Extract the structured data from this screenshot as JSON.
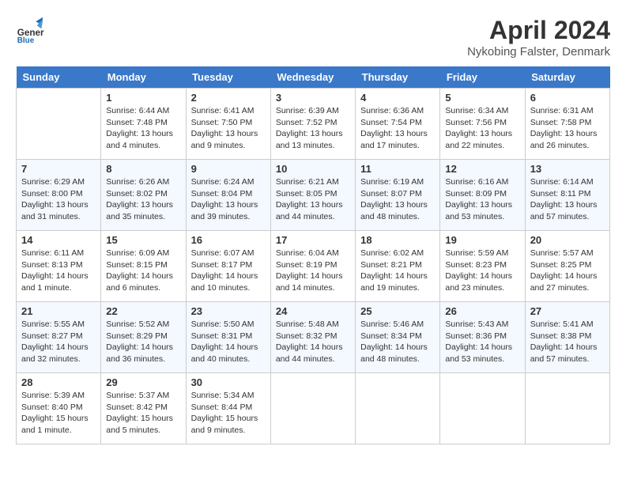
{
  "header": {
    "logo_line1": "General",
    "logo_line2": "Blue",
    "month": "April 2024",
    "location": "Nykobing Falster, Denmark"
  },
  "days_of_week": [
    "Sunday",
    "Monday",
    "Tuesday",
    "Wednesday",
    "Thursday",
    "Friday",
    "Saturday"
  ],
  "weeks": [
    [
      {
        "day": "",
        "info": ""
      },
      {
        "day": "1",
        "info": "Sunrise: 6:44 AM\nSunset: 7:48 PM\nDaylight: 13 hours\nand 4 minutes."
      },
      {
        "day": "2",
        "info": "Sunrise: 6:41 AM\nSunset: 7:50 PM\nDaylight: 13 hours\nand 9 minutes."
      },
      {
        "day": "3",
        "info": "Sunrise: 6:39 AM\nSunset: 7:52 PM\nDaylight: 13 hours\nand 13 minutes."
      },
      {
        "day": "4",
        "info": "Sunrise: 6:36 AM\nSunset: 7:54 PM\nDaylight: 13 hours\nand 17 minutes."
      },
      {
        "day": "5",
        "info": "Sunrise: 6:34 AM\nSunset: 7:56 PM\nDaylight: 13 hours\nand 22 minutes."
      },
      {
        "day": "6",
        "info": "Sunrise: 6:31 AM\nSunset: 7:58 PM\nDaylight: 13 hours\nand 26 minutes."
      }
    ],
    [
      {
        "day": "7",
        "info": "Sunrise: 6:29 AM\nSunset: 8:00 PM\nDaylight: 13 hours\nand 31 minutes."
      },
      {
        "day": "8",
        "info": "Sunrise: 6:26 AM\nSunset: 8:02 PM\nDaylight: 13 hours\nand 35 minutes."
      },
      {
        "day": "9",
        "info": "Sunrise: 6:24 AM\nSunset: 8:04 PM\nDaylight: 13 hours\nand 39 minutes."
      },
      {
        "day": "10",
        "info": "Sunrise: 6:21 AM\nSunset: 8:05 PM\nDaylight: 13 hours\nand 44 minutes."
      },
      {
        "day": "11",
        "info": "Sunrise: 6:19 AM\nSunset: 8:07 PM\nDaylight: 13 hours\nand 48 minutes."
      },
      {
        "day": "12",
        "info": "Sunrise: 6:16 AM\nSunset: 8:09 PM\nDaylight: 13 hours\nand 53 minutes."
      },
      {
        "day": "13",
        "info": "Sunrise: 6:14 AM\nSunset: 8:11 PM\nDaylight: 13 hours\nand 57 minutes."
      }
    ],
    [
      {
        "day": "14",
        "info": "Sunrise: 6:11 AM\nSunset: 8:13 PM\nDaylight: 14 hours\nand 1 minute."
      },
      {
        "day": "15",
        "info": "Sunrise: 6:09 AM\nSunset: 8:15 PM\nDaylight: 14 hours\nand 6 minutes."
      },
      {
        "day": "16",
        "info": "Sunrise: 6:07 AM\nSunset: 8:17 PM\nDaylight: 14 hours\nand 10 minutes."
      },
      {
        "day": "17",
        "info": "Sunrise: 6:04 AM\nSunset: 8:19 PM\nDaylight: 14 hours\nand 14 minutes."
      },
      {
        "day": "18",
        "info": "Sunrise: 6:02 AM\nSunset: 8:21 PM\nDaylight: 14 hours\nand 19 minutes."
      },
      {
        "day": "19",
        "info": "Sunrise: 5:59 AM\nSunset: 8:23 PM\nDaylight: 14 hours\nand 23 minutes."
      },
      {
        "day": "20",
        "info": "Sunrise: 5:57 AM\nSunset: 8:25 PM\nDaylight: 14 hours\nand 27 minutes."
      }
    ],
    [
      {
        "day": "21",
        "info": "Sunrise: 5:55 AM\nSunset: 8:27 PM\nDaylight: 14 hours\nand 32 minutes."
      },
      {
        "day": "22",
        "info": "Sunrise: 5:52 AM\nSunset: 8:29 PM\nDaylight: 14 hours\nand 36 minutes."
      },
      {
        "day": "23",
        "info": "Sunrise: 5:50 AM\nSunset: 8:31 PM\nDaylight: 14 hours\nand 40 minutes."
      },
      {
        "day": "24",
        "info": "Sunrise: 5:48 AM\nSunset: 8:32 PM\nDaylight: 14 hours\nand 44 minutes."
      },
      {
        "day": "25",
        "info": "Sunrise: 5:46 AM\nSunset: 8:34 PM\nDaylight: 14 hours\nand 48 minutes."
      },
      {
        "day": "26",
        "info": "Sunrise: 5:43 AM\nSunset: 8:36 PM\nDaylight: 14 hours\nand 53 minutes."
      },
      {
        "day": "27",
        "info": "Sunrise: 5:41 AM\nSunset: 8:38 PM\nDaylight: 14 hours\nand 57 minutes."
      }
    ],
    [
      {
        "day": "28",
        "info": "Sunrise: 5:39 AM\nSunset: 8:40 PM\nDaylight: 15 hours\nand 1 minute."
      },
      {
        "day": "29",
        "info": "Sunrise: 5:37 AM\nSunset: 8:42 PM\nDaylight: 15 hours\nand 5 minutes."
      },
      {
        "day": "30",
        "info": "Sunrise: 5:34 AM\nSunset: 8:44 PM\nDaylight: 15 hours\nand 9 minutes."
      },
      {
        "day": "",
        "info": ""
      },
      {
        "day": "",
        "info": ""
      },
      {
        "day": "",
        "info": ""
      },
      {
        "day": "",
        "info": ""
      }
    ]
  ]
}
